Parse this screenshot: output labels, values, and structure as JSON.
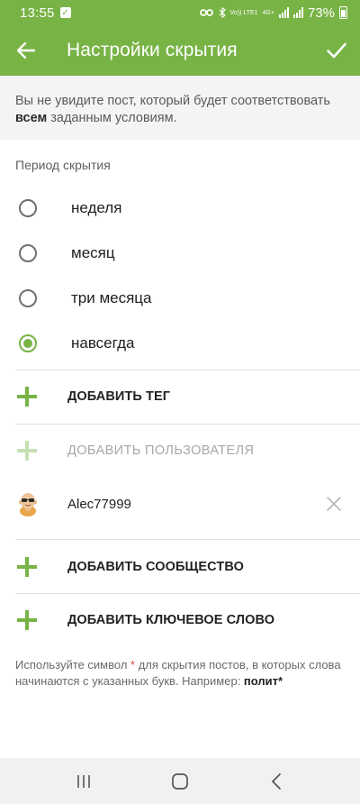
{
  "status_bar": {
    "time": "13:55",
    "battery_percent": "73%",
    "volte_label": "Vo)) LTE1",
    "network_type": "4G+"
  },
  "app_bar": {
    "title": "Настройки скрытия",
    "back_icon": "arrow-left-icon",
    "confirm_icon": "check-icon"
  },
  "notice": {
    "text_before": "Вы не увидите пост, который будет соответствовать ",
    "bold": "всем",
    "text_after": " заданным условиям."
  },
  "period": {
    "label": "Период скрытия",
    "options": [
      {
        "label": "неделя",
        "checked": false
      },
      {
        "label": "месяц",
        "checked": false
      },
      {
        "label": "три месяца",
        "checked": false
      },
      {
        "label": "навсегда",
        "checked": true
      }
    ]
  },
  "actions": {
    "add_tag": "ДОБАВИТЬ ТЕГ",
    "add_user": "ДОБАВИТЬ ПОЛЬЗОВАТЕЛЯ",
    "add_community": "ДОБАВИТЬ СООБЩЕСТВО",
    "add_keyword": "ДОБАВИТЬ КЛЮЧЕВОЕ СЛОВО"
  },
  "user": {
    "name": "Alec77999",
    "avatar_icon": "avatar-icon",
    "remove_icon": "close-icon"
  },
  "hint": {
    "text_before": "Используйте символ ",
    "star": "*",
    "text_middle": " для скрытия постов, в которых слова начинаются с указанных букв. Например: ",
    "example": "полит*"
  },
  "colors": {
    "accent": "#78b345",
    "accent_disabled": "#c7e0b3",
    "star": "#e0463a"
  },
  "nav_bar": {
    "recent_icon": "recent-apps-icon",
    "home_icon": "home-icon",
    "back_icon": "back-nav-icon"
  }
}
